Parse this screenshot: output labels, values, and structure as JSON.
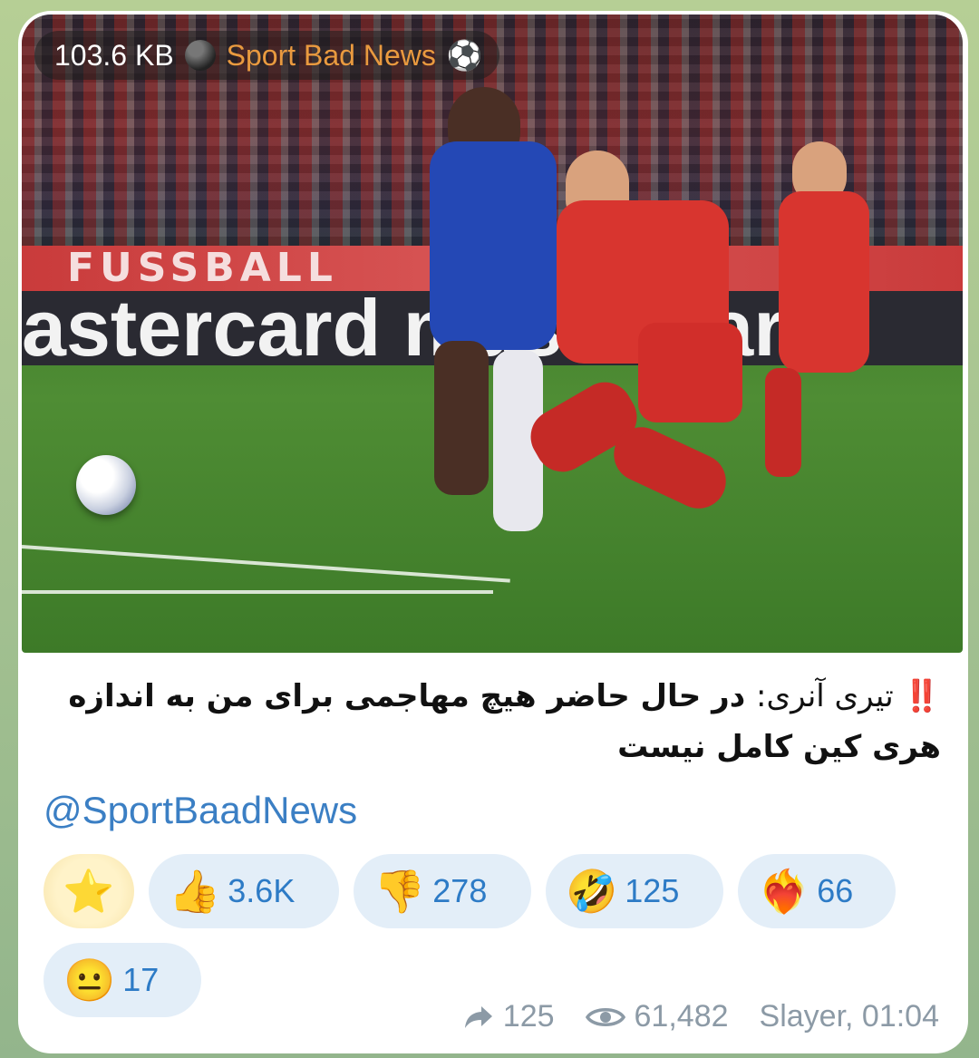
{
  "media": {
    "size": "103.6 KB",
    "channel": "Sport Bad News",
    "icons": {
      "status": "black-circle-icon",
      "channel": "soccer-ball-icon"
    },
    "board_top_text": "FUSSBALL",
    "board_text": "astercard mastercard"
  },
  "post": {
    "mark": "‼️",
    "text_lead": "تیری آنری:",
    "text_body": " در حال حاضر هیچ مهاجمی برای من به اندازه هری کین کامل نیست",
    "handle": "@SportBaadNews"
  },
  "reactions": [
    {
      "emoji": "⭐",
      "name": "star-reaction",
      "count": ""
    },
    {
      "emoji": "👍",
      "name": "thumbs-up-reaction",
      "count": "3.6K"
    },
    {
      "emoji": "👎",
      "name": "thumbs-down-reaction",
      "count": "278"
    },
    {
      "emoji": "🤣",
      "name": "rofl-reaction",
      "count": "125"
    },
    {
      "emoji": "❤️‍🔥",
      "name": "heart-on-fire-reaction",
      "count": "66"
    },
    {
      "emoji": "😐",
      "name": "neutral-face-reaction",
      "count": "17"
    }
  ],
  "footer": {
    "forwards": "125",
    "views": "61,482",
    "author_time": "Slayer, 01:04"
  },
  "colors": {
    "accent": "#2d7bc6",
    "channel": "#e99a3f",
    "reaction_bg": "#e3eef8",
    "meta": "#8c9aa6"
  }
}
